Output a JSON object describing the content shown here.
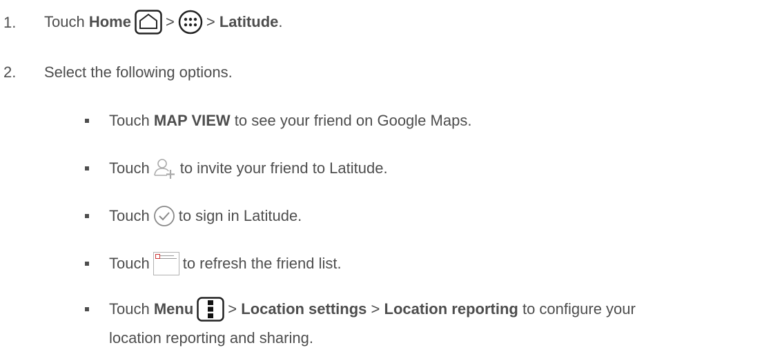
{
  "steps": [
    {
      "number": "1.",
      "touch": "Touch",
      "home": "Home",
      "sep1": ">",
      "sep2": ">",
      "latitude": "Latitude",
      "period": "."
    },
    {
      "number": "2.",
      "text": "Select the following options."
    }
  ],
  "options": [
    {
      "touch": "Touch",
      "label": "MAP VIEW",
      "rest": "to see your friend on Google Maps."
    },
    {
      "touch": "Touch",
      "rest": "to invite your friend to Latitude.",
      "icon": "add-person-icon"
    },
    {
      "touch": "Touch",
      "rest": "to sign in Latitude.",
      "icon": "check-circle-icon"
    },
    {
      "touch": "Touch",
      "rest": "to refresh the friend list.",
      "icon": "refresh-icon"
    },
    {
      "touch": "Touch",
      "menu": "Menu",
      "sep1": ">",
      "location_settings": "Location settings",
      "sep2": ">",
      "location_reporting": "Location reporting",
      "rest": "to configure your",
      "rest2": "location reporting and sharing.",
      "icon": "menu-icon"
    }
  ],
  "colors": {
    "text": "#4d4d4d"
  }
}
